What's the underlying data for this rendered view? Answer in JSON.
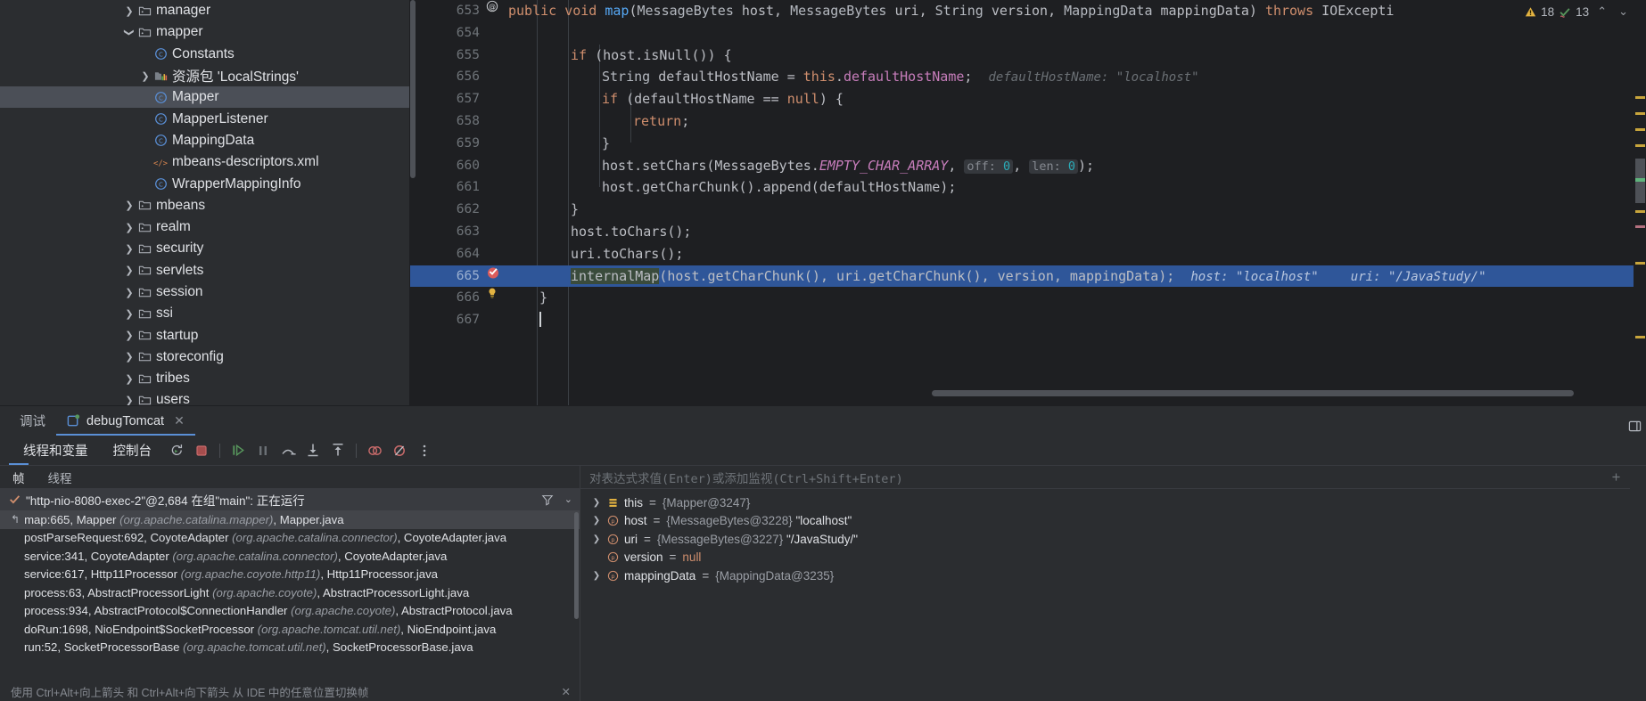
{
  "project_tree": {
    "items": [
      {
        "label": "manager",
        "type": "folder",
        "indent": 1,
        "arrow": "collapsed",
        "selected": false
      },
      {
        "label": "mapper",
        "type": "folder",
        "indent": 1,
        "arrow": "expanded",
        "selected": false
      },
      {
        "label": "Constants",
        "type": "class",
        "indent": 2,
        "arrow": "none",
        "selected": false
      },
      {
        "label": "资源包 'LocalStrings'",
        "type": "resource-bundle",
        "indent": 2,
        "arrow": "collapsed",
        "selected": false
      },
      {
        "label": "Mapper",
        "type": "class",
        "indent": 2,
        "arrow": "none",
        "selected": true
      },
      {
        "label": "MapperListener",
        "type": "class",
        "indent": 2,
        "arrow": "none",
        "selected": false
      },
      {
        "label": "MappingData",
        "type": "class",
        "indent": 2,
        "arrow": "none",
        "selected": false
      },
      {
        "label": "mbeans-descriptors.xml",
        "type": "xml",
        "indent": 2,
        "arrow": "none",
        "selected": false
      },
      {
        "label": "WrapperMappingInfo",
        "type": "class",
        "indent": 2,
        "arrow": "none",
        "selected": false
      },
      {
        "label": "mbeans",
        "type": "folder",
        "indent": 1,
        "arrow": "collapsed",
        "selected": false
      },
      {
        "label": "realm",
        "type": "folder",
        "indent": 1,
        "arrow": "collapsed",
        "selected": false
      },
      {
        "label": "security",
        "type": "folder",
        "indent": 1,
        "arrow": "collapsed",
        "selected": false
      },
      {
        "label": "servlets",
        "type": "folder",
        "indent": 1,
        "arrow": "collapsed",
        "selected": false
      },
      {
        "label": "session",
        "type": "folder",
        "indent": 1,
        "arrow": "collapsed",
        "selected": false
      },
      {
        "label": "ssi",
        "type": "folder",
        "indent": 1,
        "arrow": "collapsed",
        "selected": false
      },
      {
        "label": "startup",
        "type": "folder",
        "indent": 1,
        "arrow": "collapsed",
        "selected": false
      },
      {
        "label": "storeconfig",
        "type": "folder",
        "indent": 1,
        "arrow": "collapsed",
        "selected": false
      },
      {
        "label": "tribes",
        "type": "folder",
        "indent": 1,
        "arrow": "collapsed",
        "selected": false
      },
      {
        "label": "users",
        "type": "folder",
        "indent": 1,
        "arrow": "collapsed",
        "selected": false
      }
    ]
  },
  "editor": {
    "status": {
      "warnings": "18",
      "checks": "13"
    },
    "lines": [
      {
        "num": "653",
        "gutter": "annotation",
        "exec": false
      },
      {
        "num": "654",
        "gutter": "",
        "exec": false
      },
      {
        "num": "655",
        "gutter": "",
        "exec": false
      },
      {
        "num": "656",
        "gutter": "",
        "exec": false
      },
      {
        "num": "657",
        "gutter": "",
        "exec": false
      },
      {
        "num": "658",
        "gutter": "",
        "exec": false
      },
      {
        "num": "659",
        "gutter": "",
        "exec": false
      },
      {
        "num": "660",
        "gutter": "",
        "exec": false
      },
      {
        "num": "661",
        "gutter": "",
        "exec": false
      },
      {
        "num": "662",
        "gutter": "",
        "exec": false
      },
      {
        "num": "663",
        "gutter": "",
        "exec": false
      },
      {
        "num": "664",
        "gutter": "",
        "exec": false
      },
      {
        "num": "665",
        "gutter": "breakpoint",
        "exec": true
      },
      {
        "num": "666",
        "gutter": "intention-bulb",
        "exec": false
      },
      {
        "num": "667",
        "gutter": "",
        "exec": false
      }
    ],
    "code": {
      "l653": "public void map(MessageBytes host, MessageBytes uri, String version, MappingData mappingData) throws IOExcepti",
      "l655": "if (host.isNull()) {",
      "l656": "String defaultHostName = this.defaultHostName;",
      "l656_hint": "defaultHostName: \"localhost\"",
      "l657": "if (defaultHostName == null) {",
      "l658": "return;",
      "l659": "}",
      "l660_a": "host.setChars(MessageBytes.",
      "l660_static": "EMPTY_CHAR_ARRAY",
      "l660_off_label": "off:",
      "l660_off_val": "0",
      "l660_len_label": "len:",
      "l660_len_val": "0",
      "l661": "host.getCharChunk().append(defaultHostName);",
      "l662": "}",
      "l663": "host.toChars();",
      "l664": "uri.toChars();",
      "l665_call": "internalMap",
      "l665_args": "(host.getCharChunk(), uri.getCharChunk(), version, mappingData);",
      "l665_hint_host": "host: \"localhost\"",
      "l665_hint_uri": "uri: \"/JavaStudy/\"",
      "l666": "}"
    }
  },
  "debug_panel": {
    "tabs": {
      "title": "调试",
      "session": "debugTomcat",
      "close": "✕"
    },
    "toolbar": {
      "threads_and_variables": "线程和变量",
      "console": "控制台",
      "icons": [
        "rerun-icon",
        "stop-icon",
        "resume-icon",
        "pause-icon",
        "step-over-icon",
        "step-into-icon",
        "step-out-icon",
        "mute-breakpoints-icon",
        "view-breakpoints-icon",
        "more-options-icon"
      ]
    },
    "frames": {
      "tab_frames": "帧",
      "tab_threads": "线程",
      "thread_label": "\"http-nio-8080-exec-2\"@2,684 在组\"main\": 正在运行",
      "rows": [
        {
          "method": "map:665,",
          "cls": "Mapper",
          "pkg": "(org.apache.catalina.mapper)",
          "file": "Mapper.java",
          "selected": true
        },
        {
          "method": "postParseRequest:692,",
          "cls": "CoyoteAdapter",
          "pkg": "(org.apache.catalina.connector)",
          "file": "CoyoteAdapter.java",
          "selected": false
        },
        {
          "method": "service:341,",
          "cls": "CoyoteAdapter",
          "pkg": "(org.apache.catalina.connector)",
          "file": "CoyoteAdapter.java",
          "selected": false
        },
        {
          "method": "service:617,",
          "cls": "Http11Processor",
          "pkg": "(org.apache.coyote.http11)",
          "file": "Http11Processor.java",
          "selected": false
        },
        {
          "method": "process:63,",
          "cls": "AbstractProcessorLight",
          "pkg": "(org.apache.coyote)",
          "file": "AbstractProcessorLight.java",
          "selected": false
        },
        {
          "method": "process:934,",
          "cls": "AbstractProtocol$ConnectionHandler",
          "pkg": "(org.apache.coyote)",
          "file": "AbstractProtocol.java",
          "selected": false
        },
        {
          "method": "doRun:1698,",
          "cls": "NioEndpoint$SocketProcessor",
          "pkg": "(org.apache.tomcat.util.net)",
          "file": "NioEndpoint.java",
          "selected": false
        },
        {
          "method": "run:52,",
          "cls": "SocketProcessorBase",
          "pkg": "(org.apache.tomcat.util.net)",
          "file": "SocketProcessorBase.java",
          "selected": false
        }
      ],
      "hint_text": "使用 Ctrl+Alt+向上箭头 和 Ctrl+Alt+向下箭头 从 IDE 中的任意位置切换帧",
      "hint_close": "✕"
    },
    "variables": {
      "watch_placeholder": "对表达式求值(Enter)或添加监视(Ctrl+Shift+Enter)",
      "rows": [
        {
          "expandable": true,
          "icon": "object-icon",
          "name": "this",
          "ref": "{Mapper@3247}",
          "value": ""
        },
        {
          "expandable": true,
          "icon": "param-icon",
          "name": "host",
          "ref": "{MessageBytes@3228}",
          "value": "\"localhost\""
        },
        {
          "expandable": true,
          "icon": "param-icon",
          "name": "uri",
          "ref": "{MessageBytes@3227}",
          "value": "\"/JavaStudy/\""
        },
        {
          "expandable": false,
          "icon": "param-icon",
          "name": "version",
          "ref": "",
          "value": "null"
        },
        {
          "expandable": true,
          "icon": "param-icon",
          "name": "mappingData",
          "ref": "{MappingData@3235}",
          "value": ""
        }
      ]
    }
  },
  "colors": {
    "bg_editor": "#1e1f22",
    "bg_panel": "#2b2d30",
    "exec_line": "#2f5699",
    "selection": "#4b4f57",
    "accent_blue": "#5a8fd6",
    "keyword": "#cf8e6d",
    "method": "#56a8f5",
    "string": "#6aab73",
    "number": "#2aacb8",
    "field": "#c77dbb",
    "warning": "#e3b341",
    "breakpoint": "#db5c5c"
  }
}
